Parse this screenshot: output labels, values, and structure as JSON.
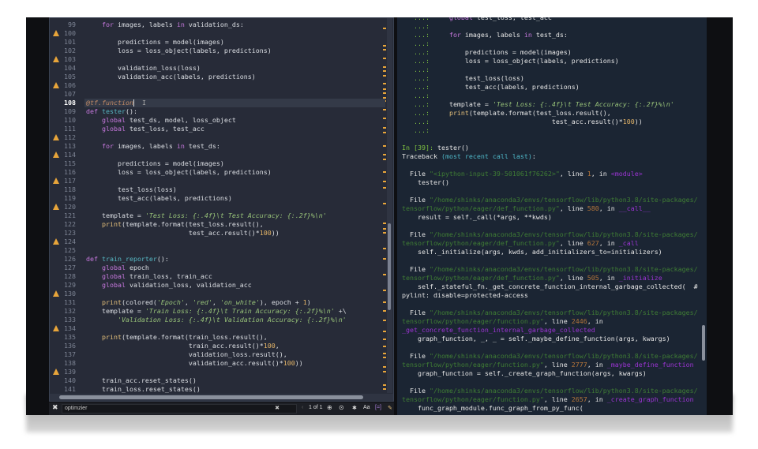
{
  "editor": {
    "first_line": 99,
    "current_line": 108,
    "warning_lines": [
      100,
      103,
      106,
      112,
      114,
      117,
      120,
      124,
      130,
      134,
      139
    ],
    "lines": [
      [
        [
          "k",
          "    for"
        ],
        [
          "p",
          " images, labels "
        ],
        [
          "k",
          "in"
        ],
        [
          "p",
          " validation_ds:"
        ]
      ],
      [],
      [
        [
          "p",
          "        predictions = model(images)"
        ]
      ],
      [
        [
          "p",
          "        loss = loss_object(labels, predictions)"
        ]
      ],
      [],
      [
        [
          "p",
          "        validation_loss(loss)"
        ]
      ],
      [
        [
          "p",
          "        validation_acc(labels, predictions)"
        ]
      ],
      [],
      [],
      [
        [
          "d",
          "@tf.function"
        ]
      ],
      [
        [
          "k",
          "def "
        ],
        [
          "f",
          "tester"
        ],
        [
          "p",
          "():"
        ]
      ],
      [
        [
          "k",
          "    global"
        ],
        [
          "p",
          " test_ds, model, loss_object"
        ]
      ],
      [
        [
          "k",
          "    global"
        ],
        [
          "p",
          " test_loss, test_acc"
        ]
      ],
      [],
      [
        [
          "k",
          "    for"
        ],
        [
          "p",
          " images, labels "
        ],
        [
          "k",
          "in"
        ],
        [
          "p",
          " test_ds:"
        ]
      ],
      [],
      [
        [
          "p",
          "        predictions = model(images)"
        ]
      ],
      [
        [
          "p",
          "        loss = loss_object(labels, predictions)"
        ]
      ],
      [],
      [
        [
          "p",
          "        test_loss(loss)"
        ]
      ],
      [
        [
          "p",
          "        test_acc(labels, predictions)"
        ]
      ],
      [],
      [
        [
          "p",
          "    template = "
        ],
        [
          "s",
          "'Test Loss: {:.4f}\\t Test Accuracy: {:.2f}%\\n'"
        ]
      ],
      [
        [
          "b",
          "    print"
        ],
        [
          "p",
          "(template.format(test_loss.result(),"
        ]
      ],
      [
        [
          "p",
          "                          test_acc.result()*"
        ],
        [
          "n",
          "100"
        ],
        [
          "p",
          "))"
        ]
      ],
      [],
      [],
      [
        [
          "k",
          "def "
        ],
        [
          "f",
          "train_reporter"
        ],
        [
          "p",
          "():"
        ]
      ],
      [
        [
          "k",
          "    global"
        ],
        [
          "p",
          " epoch"
        ]
      ],
      [
        [
          "k",
          "    global"
        ],
        [
          "p",
          " train_loss, train_acc"
        ]
      ],
      [
        [
          "k",
          "    global"
        ],
        [
          "p",
          " validation_loss, validation_acc"
        ]
      ],
      [],
      [
        [
          "b",
          "    print"
        ],
        [
          "p",
          "(colored("
        ],
        [
          "s",
          "'Epoch'"
        ],
        [
          "p",
          ", "
        ],
        [
          "s",
          "'red'"
        ],
        [
          "p",
          ", "
        ],
        [
          "s",
          "'on_white'"
        ],
        [
          "p",
          "), epoch + "
        ],
        [
          "n",
          "1"
        ],
        [
          "p",
          ")"
        ]
      ],
      [
        [
          "p",
          "    template = "
        ],
        [
          "s",
          "'Train Loss: {:.4f}\\t Train Accuracy: {:.2f}%\\n'"
        ],
        [
          "p",
          " +\\"
        ]
      ],
      [
        [
          "s",
          "        'Validation Loss: {:.4f}\\t Validation Accuracy: {:.2f}%\\n'"
        ]
      ],
      [],
      [
        [
          "b",
          "    print"
        ],
        [
          "p",
          "(template.format(train_loss.result(),"
        ]
      ],
      [
        [
          "p",
          "                          train_acc.result()*"
        ],
        [
          "n",
          "100"
        ],
        [
          "p",
          ","
        ]
      ],
      [
        [
          "p",
          "                          validation_loss.result(),"
        ]
      ],
      [
        [
          "p",
          "                          validation_acc.result()*"
        ],
        [
          "n",
          "100"
        ],
        [
          "p",
          "))"
        ]
      ],
      [],
      [
        [
          "p",
          "    train_acc.reset_states()"
        ]
      ],
      [
        [
          "p",
          "    train_loss.reset_states()"
        ]
      ]
    ]
  },
  "findbar": {
    "query": "optimzier",
    "match_count": "1 of 1",
    "case_label": "Aa"
  },
  "console": {
    "lines": [
      [
        [
          "g",
          "   ...:"
        ],
        [
          "k",
          "     global"
        ],
        [
          "w",
          " test_loss, test_acc"
        ]
      ],
      [
        [
          "g",
          "   ...:"
        ]
      ],
      [
        [
          "g",
          "   ...:"
        ],
        [
          "k",
          "     for"
        ],
        [
          "w",
          " images, labels "
        ],
        [
          "k",
          "in"
        ],
        [
          "w",
          " test_ds:"
        ]
      ],
      [
        [
          "g",
          "   ...:"
        ]
      ],
      [
        [
          "g",
          "   ...:"
        ],
        [
          "w",
          "         predictions = model(images)"
        ]
      ],
      [
        [
          "g",
          "   ...:"
        ],
        [
          "w",
          "         loss = loss_object(labels, predictions)"
        ]
      ],
      [
        [
          "g",
          "   ...:"
        ]
      ],
      [
        [
          "g",
          "   ...:"
        ],
        [
          "w",
          "         test_loss(loss)"
        ]
      ],
      [
        [
          "g",
          "   ...:"
        ],
        [
          "w",
          "         test_acc(labels, predictions)"
        ]
      ],
      [
        [
          "g",
          "   ...:"
        ]
      ],
      [
        [
          "g",
          "   ...:"
        ],
        [
          "w",
          "     template = "
        ],
        [
          "s",
          "'Test Loss: {:.4f}\\t Test Accuracy: {:.2f}%\\n'"
        ]
      ],
      [
        [
          "g",
          "   ...:"
        ],
        [
          "b",
          "     print"
        ],
        [
          "w",
          "(template.format(test_loss.result(),"
        ]
      ],
      [
        [
          "g",
          "   ...:"
        ],
        [
          "w",
          "                               test_acc.result()*"
        ],
        [
          "n",
          "100"
        ],
        [
          "w",
          "))"
        ]
      ],
      [
        [
          "g",
          "   ...:"
        ]
      ],
      [],
      [
        [
          "g",
          "In [39]: "
        ],
        [
          "w",
          "tester()"
        ]
      ],
      [
        [
          "w",
          "Traceback "
        ],
        [
          "c",
          "(most recent call last)"
        ],
        [
          "w",
          ":"
        ]
      ],
      [],
      [
        [
          "w",
          "  File "
        ],
        [
          "path",
          "\"<ipython-input-39-501061f76262>\""
        ],
        [
          "w",
          ", line "
        ],
        [
          "ln",
          "1"
        ],
        [
          "w",
          ", in "
        ],
        [
          "fn",
          "<module>"
        ]
      ],
      [
        [
          "w",
          "    tester()"
        ]
      ],
      [],
      [
        [
          "w",
          "  File "
        ],
        [
          "path",
          "\"/home/shinks/anaconda3/envs/tensorflow/lib/python3.8/site-packages/"
        ]
      ],
      [
        [
          "path",
          "tensorflow/python/eager/def_function.py\""
        ],
        [
          "w",
          ", line "
        ],
        [
          "ln",
          "580"
        ],
        [
          "w",
          ", in "
        ],
        [
          "fn",
          "__call__"
        ]
      ],
      [
        [
          "w",
          "    result = self._call(*args, **kwds)"
        ]
      ],
      [],
      [
        [
          "w",
          "  File "
        ],
        [
          "path",
          "\"/home/shinks/anaconda3/envs/tensorflow/lib/python3.8/site-packages/"
        ]
      ],
      [
        [
          "path",
          "tensorflow/python/eager/def_function.py\""
        ],
        [
          "w",
          ", line "
        ],
        [
          "ln",
          "627"
        ],
        [
          "w",
          ", in "
        ],
        [
          "fn",
          "_call"
        ]
      ],
      [
        [
          "w",
          "    self._initialize(args, kwds, add_initializers_to=initializers)"
        ]
      ],
      [],
      [
        [
          "w",
          "  File "
        ],
        [
          "path",
          "\"/home/shinks/anaconda3/envs/tensorflow/lib/python3.8/site-packages/"
        ]
      ],
      [
        [
          "path",
          "tensorflow/python/eager/def_function.py\""
        ],
        [
          "w",
          ", line "
        ],
        [
          "ln",
          "505"
        ],
        [
          "w",
          ", in "
        ],
        [
          "fn",
          "_initialize"
        ]
      ],
      [
        [
          "w",
          "    self._stateful_fn._get_concrete_function_internal_garbage_collected(  #"
        ]
      ],
      [
        [
          "w",
          "pylint: disable=protected-access"
        ]
      ],
      [],
      [
        [
          "w",
          "  File "
        ],
        [
          "path",
          "\"/home/shinks/anaconda3/envs/tensorflow/lib/python3.8/site-packages/"
        ]
      ],
      [
        [
          "path",
          "tensorflow/python/eager/function.py\""
        ],
        [
          "w",
          ", line "
        ],
        [
          "ln",
          "2446"
        ],
        [
          "w",
          ", in"
        ]
      ],
      [
        [
          "fn",
          "_get_concrete_function_internal_garbage_collected"
        ]
      ],
      [
        [
          "w",
          "    graph_function, _, _ = self._maybe_define_function(args, kwargs)"
        ]
      ],
      [],
      [
        [
          "w",
          "  File "
        ],
        [
          "path",
          "\"/home/shinks/anaconda3/envs/tensorflow/lib/python3.8/site-packages/"
        ]
      ],
      [
        [
          "path",
          "tensorflow/python/eager/function.py\""
        ],
        [
          "w",
          ", line "
        ],
        [
          "ln",
          "2777"
        ],
        [
          "w",
          ", in "
        ],
        [
          "fn",
          "_maybe_define_function"
        ]
      ],
      [
        [
          "w",
          "    graph_function = self._create_graph_function(args, kwargs)"
        ]
      ],
      [],
      [
        [
          "w",
          "  File "
        ],
        [
          "path",
          "\"/home/shinks/anaconda3/envs/tensorflow/lib/python3.8/site-packages/"
        ]
      ],
      [
        [
          "path",
          "tensorflow/python/eager/function.py\""
        ],
        [
          "w",
          ", line "
        ],
        [
          "ln",
          "2657"
        ],
        [
          "w",
          ", in "
        ],
        [
          "fn",
          "_create_graph_function"
        ]
      ],
      [
        [
          "w",
          "    func_graph_module.func_graph_from_py_func("
        ]
      ]
    ]
  },
  "colors": {
    "warning": "#e8a53a",
    "editor_bg": "#272b38",
    "console_bg": "#1b2533"
  }
}
